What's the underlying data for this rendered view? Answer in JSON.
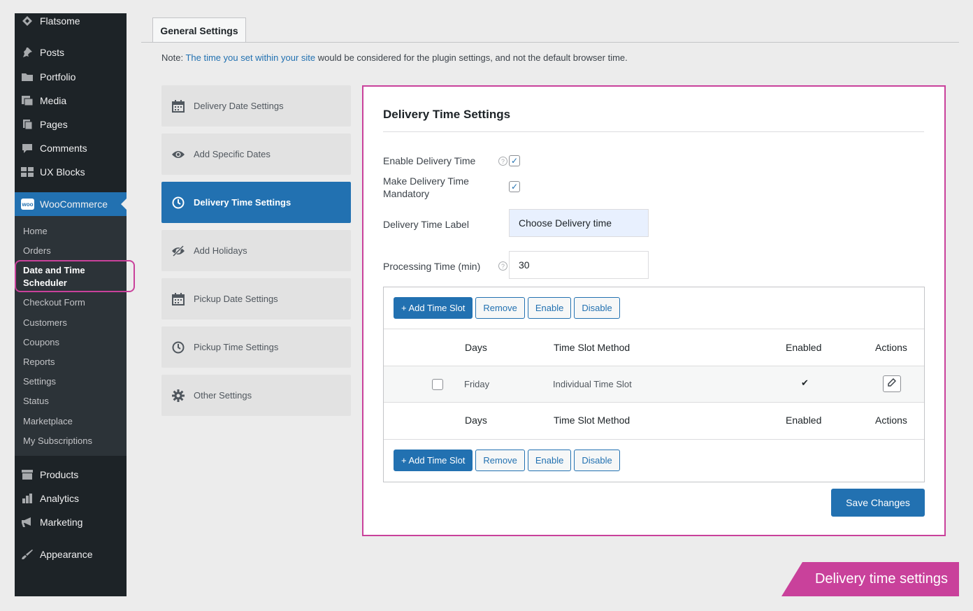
{
  "sidebar": {
    "top_items": [
      {
        "label": "Flatsome",
        "icon": "flatsome-icon"
      },
      {
        "label": "Posts",
        "icon": "pin-icon"
      },
      {
        "label": "Portfolio",
        "icon": "folder-icon"
      },
      {
        "label": "Media",
        "icon": "media-icon"
      },
      {
        "label": "Pages",
        "icon": "pages-icon"
      },
      {
        "label": "Comments",
        "icon": "comment-icon"
      },
      {
        "label": "UX Blocks",
        "icon": "blocks-icon"
      }
    ],
    "woo_label": "WooCommerce",
    "woo_badge": "woo",
    "sub_items": [
      "Home",
      "Orders",
      "Date and Time Scheduler",
      "Checkout Form",
      "Customers",
      "Coupons",
      "Reports",
      "Settings",
      "Status",
      "Marketplace",
      "My Subscriptions"
    ],
    "bottom_items": [
      {
        "label": "Products",
        "icon": "archive-icon"
      },
      {
        "label": "Analytics",
        "icon": "bar-chart-icon"
      },
      {
        "label": "Marketing",
        "icon": "megaphone-icon"
      },
      {
        "label": "Appearance",
        "icon": "brush-icon"
      }
    ]
  },
  "tab": {
    "label": "General Settings"
  },
  "note": {
    "prefix": "Note: ",
    "link": "The time you set within your site",
    "suffix": " would be considered for the plugin settings, and not the default browser time."
  },
  "settings_menu": [
    {
      "label": "Delivery Date Settings",
      "icon": "calendar-icon"
    },
    {
      "label": "Add Specific Dates",
      "icon": "eye-icon"
    },
    {
      "label": "Delivery Time Settings",
      "icon": "clock-icon",
      "active": true
    },
    {
      "label": "Add Holidays",
      "icon": "eye-slash-icon"
    },
    {
      "label": "Pickup Date Settings",
      "icon": "calendar-icon"
    },
    {
      "label": "Pickup Time Settings",
      "icon": "clock-icon"
    },
    {
      "label": "Other Settings",
      "icon": "gear-icon"
    }
  ],
  "panel": {
    "title": "Delivery Time Settings",
    "enable_label": "Enable Delivery Time",
    "enable_checked": true,
    "mandatory_label": "Make Delivery Time Mandatory",
    "mandatory_checked": true,
    "label_field_label": "Delivery Time Label",
    "label_field_value": "Choose Delivery time",
    "processing_label": "Processing Time (min)",
    "processing_value": "30",
    "help_glyph": "?",
    "check_glyph": "✓",
    "buttons": {
      "add": "+ Add Time Slot",
      "remove": "Remove",
      "enable": "Enable",
      "disable": "Disable"
    },
    "table": {
      "headers": {
        "days": "Days",
        "method": "Time Slot Method",
        "enabled": "Enabled",
        "actions": "Actions"
      },
      "rows": [
        {
          "day": "Friday",
          "method": "Individual Time Slot",
          "enabled_mark": "✔"
        }
      ]
    },
    "save_label": "Save Changes"
  },
  "banner": {
    "text": "Delivery time settings"
  },
  "colors": {
    "accent": "#2271b1",
    "highlight": "#c9419b",
    "sidebar": "#1d2327"
  }
}
